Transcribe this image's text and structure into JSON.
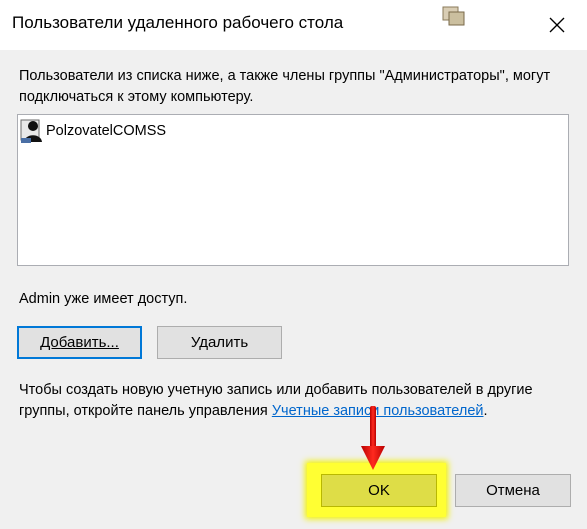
{
  "window": {
    "title": "Пользователи удаленного рабочего стола",
    "app_icon": "remote-users-icon",
    "close_icon": "close-icon"
  },
  "description": "Пользователи из списка ниже, а также члены группы \"Администраторы\", могут подключаться к этому компьютеру.",
  "users": [
    {
      "name": "PolzovatelCOMSS",
      "icon": "user-icon"
    }
  ],
  "status_text": "Admin уже имеет доступ.",
  "buttons": {
    "add": "Добавить...",
    "remove": "Удалить",
    "ok": "OK",
    "cancel": "Отмена"
  },
  "info": {
    "text": "Чтобы создать новую учетную запись или добавить пользователей в другие группы, откройте панель управления ",
    "link": "Учетные записи пользователей",
    "suffix": "."
  },
  "colors": {
    "highlight": "#ffff33",
    "arrow": "#e8120c",
    "link": "#0066cc",
    "focus_border": "#0078d7"
  }
}
